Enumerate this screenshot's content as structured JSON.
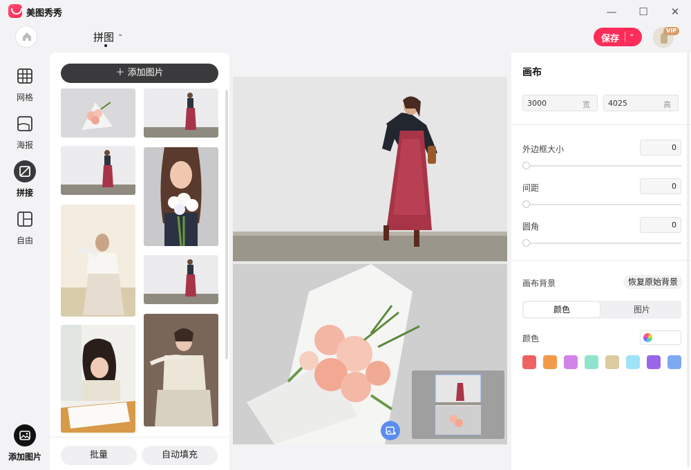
{
  "app": {
    "name": "美图秀秀"
  },
  "header": {
    "mode_title": "拼图",
    "save_label": "保存",
    "vip_label": "VIP"
  },
  "nav": {
    "items": [
      {
        "label": "网格",
        "icon": "grid-icon"
      },
      {
        "label": "海报",
        "icon": "poster-icon"
      },
      {
        "label": "拼接",
        "icon": "stitch-icon",
        "active": true
      },
      {
        "label": "自由",
        "icon": "free-layout-icon"
      }
    ],
    "add_photo_label": "添加图片"
  },
  "image_panel": {
    "add_button_label": "添加图片",
    "footer": {
      "batch_label": "批量",
      "autofill_label": "自动填充"
    }
  },
  "settings": {
    "canvas_title": "画布",
    "width": {
      "value": "3000",
      "unit": "宽"
    },
    "height": {
      "value": "4025",
      "unit": "高"
    },
    "border": {
      "label": "外边框大小",
      "value": "0"
    },
    "spacing": {
      "label": "间距",
      "value": "0"
    },
    "corner": {
      "label": "圆角",
      "value": "0"
    },
    "background": {
      "label": "画布背景",
      "restore_label": "恢复原始背景",
      "tabs": [
        "颜色",
        "图片"
      ],
      "active_tab": "颜色",
      "color_label": "颜色",
      "swatches": [
        "#f06262",
        "#f2994a",
        "#d084e8",
        "#8fe3cc",
        "#dccba0",
        "#9fe3f6",
        "#9a66e8",
        "#7fa8f2"
      ]
    }
  },
  "colors": {
    "accent": "#ff2d5a",
    "dark": "#3a3a3c"
  }
}
